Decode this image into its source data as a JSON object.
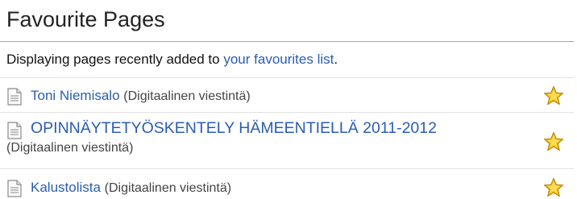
{
  "title": "Favourite Pages",
  "intro": {
    "prefix": "Displaying pages recently added to ",
    "link": "your favourites list",
    "suffix": "."
  },
  "items": [
    {
      "title": "Toni Niemisalo",
      "space": "(Digitaalinen viestintä)",
      "icon": "page-icon",
      "action_icon": "star-icon"
    },
    {
      "title": "OPINNÄYTETYÖSKENTELY HÄMEENTIELLÄ 2011-2012",
      "space": "(Digitaalinen viestintä)",
      "icon": "page-icon",
      "action_icon": "star-icon"
    },
    {
      "title": "Kalustolista",
      "space": "(Digitaalinen viestintä)",
      "icon": "page-icon",
      "action_icon": "star-icon"
    }
  ],
  "colors": {
    "link": "#2a5db0",
    "star": "#f6c60e"
  }
}
